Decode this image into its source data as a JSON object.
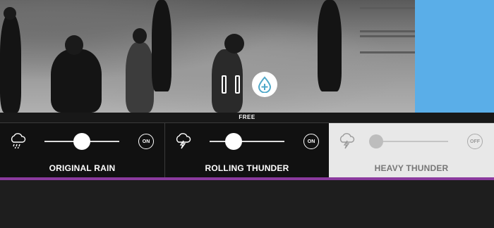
{
  "free_label": "FREE",
  "colors": {
    "accent_blue": "#5aaee8",
    "purple_bar": "#8b3a9e",
    "drop_icon": "#4fa8c9"
  },
  "player": {
    "pause_icon": "pause-icon",
    "drop_icon": "rain-drop-plus-icon"
  },
  "sounds": [
    {
      "title": "ORIGINAL RAIN",
      "toggle": "ON",
      "icon": "rain-cloud-icon",
      "volume": 0.5,
      "state": "on"
    },
    {
      "title": "ROLLING THUNDER",
      "toggle": "ON",
      "icon": "thunder-cloud-icon",
      "volume": 0.3,
      "state": "on"
    },
    {
      "title": "HEAVY THUNDER",
      "toggle": "OFF",
      "icon": "thunder-cloud-icon",
      "volume": 0.0,
      "state": "off"
    }
  ]
}
